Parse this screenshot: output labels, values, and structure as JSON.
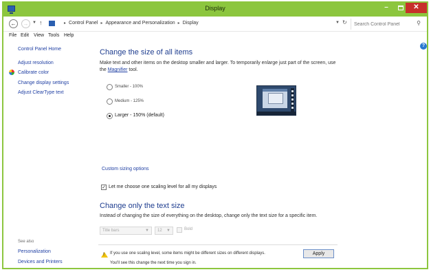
{
  "window": {
    "title": "Display",
    "controls": {
      "minimize": "–",
      "maximize": "□",
      "close": "✕"
    },
    "accent_color": "#8cc63e",
    "close_color": "#c7302b"
  },
  "address": {
    "breadcrumbs": [
      "Control Panel",
      "Appearance and Personalization",
      "Display"
    ],
    "search_placeholder": "Search Control Panel"
  },
  "menu": [
    "File",
    "Edit",
    "View",
    "Tools",
    "Help"
  ],
  "sidebar": {
    "home": "Control Panel Home",
    "items": [
      "Adjust resolution",
      "Calibrate color",
      "Change display settings",
      "Adjust ClearType text"
    ],
    "see_also_label": "See also",
    "see_also": [
      "Personalization",
      "Devices and Printers"
    ]
  },
  "main": {
    "heading": "Change the size of all items",
    "description_pre": "Make text and other items on the desktop smaller and larger. To temporarily enlarge just part of the screen, use the ",
    "magnifier_link": "Magnifier",
    "description_post": " tool.",
    "options": [
      {
        "label": "Smaller - 100%",
        "selected": false
      },
      {
        "label": "Medium - 125%",
        "selected": false
      },
      {
        "label": "Larger - 150% (default)",
        "selected": true
      }
    ],
    "custom_link": "Custom sizing options",
    "scaling_checkbox": {
      "label": "Let me choose one scaling level for all my displays",
      "checked": true
    },
    "text_size_heading": "Change only the text size",
    "text_size_description": "Instead of changing the size of everything on the desktop, change only the text size for a specific item.",
    "item_select": "Title bars",
    "size_select": "12",
    "bold_label": "Bold",
    "warning_line1": "If you use one scaling level, some items might be different sizes on different displays.",
    "warning_line2": "You'll see this change the next time you sign in.",
    "apply_label": "Apply"
  },
  "icons": {
    "help": "?",
    "back": "←",
    "forward": "→",
    "up": "↑",
    "refresh": "↻",
    "search": "⚲",
    "check": "✓",
    "warning": "!"
  }
}
